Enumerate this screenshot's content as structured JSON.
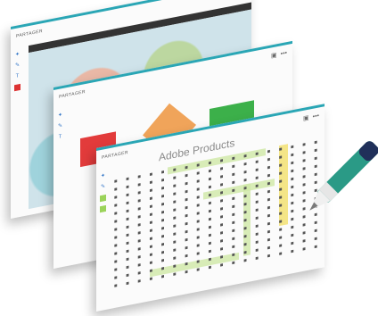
{
  "cards": [
    {
      "title": "PARTAGER"
    },
    {
      "title": "PARTAGER"
    },
    {
      "title": "PARTAGER",
      "heading": "Adobe Products"
    }
  ],
  "icons": [
    "expand-icon",
    "more-icon",
    "pen-icon"
  ],
  "colors": {
    "accent": "#2aa6b5",
    "pen": "#2a9a86"
  }
}
